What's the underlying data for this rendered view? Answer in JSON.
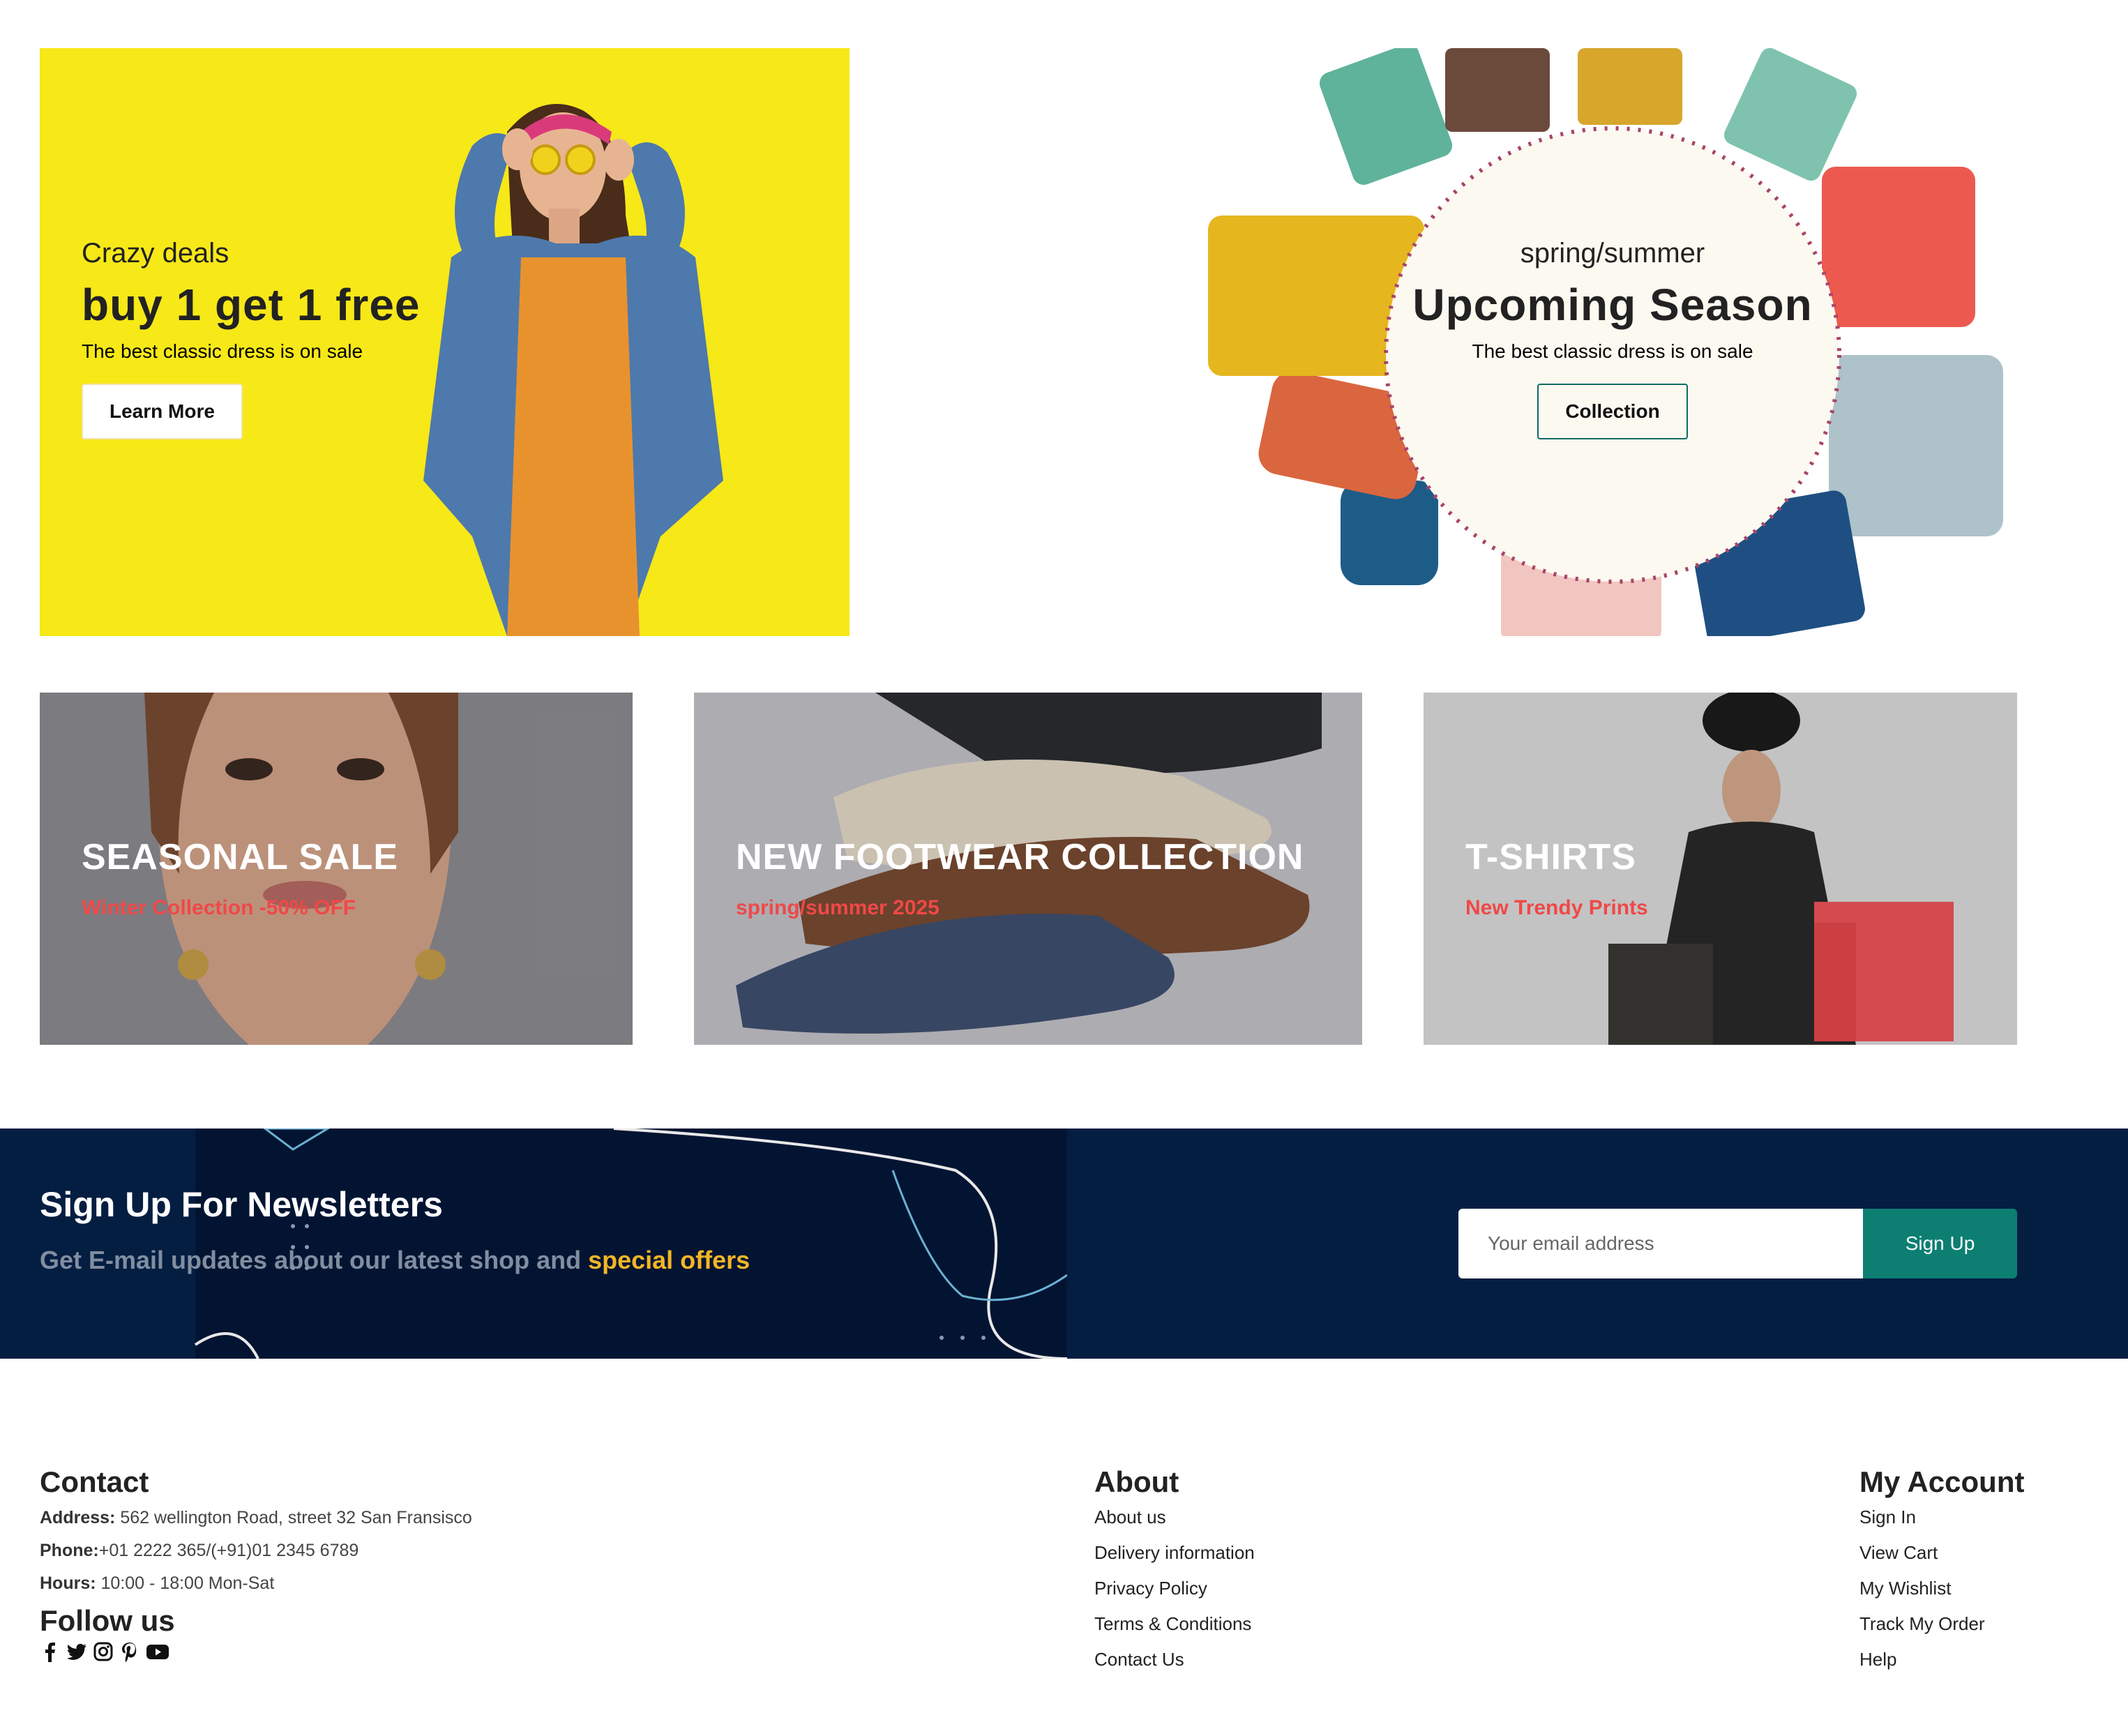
{
  "hero_left": {
    "kicker": "Crazy deals",
    "title": "buy 1 get 1 free",
    "subtitle": "The best classic dress is on sale",
    "button_label": "Learn More"
  },
  "hero_right": {
    "kicker": "spring/summer",
    "title": "Upcoming Season",
    "subtitle": "The best classic dress is on sale",
    "button_label": "Collection"
  },
  "cards": [
    {
      "title": "SEASONAL SALE",
      "subtitle": "Winter Collection -50% OFF"
    },
    {
      "title": "NEW FOOTWEAR COLLECTION",
      "subtitle": "spring/summer 2025"
    },
    {
      "title": "T-SHIRTS",
      "subtitle": "New Trendy Prints"
    }
  ],
  "newsletter": {
    "title": "Sign Up For Newsletters",
    "subtitle_prefix": "Get E-mail updates about our latest shop and ",
    "subtitle_highlight": "special offers",
    "input_placeholder": "Your email address",
    "button_label": "Sign Up"
  },
  "footer": {
    "contact": {
      "heading": "Contact",
      "address_label": "Address:",
      "address_value": " 562 wellington Road, street 32 San Fransisco",
      "phone_label": "Phone:",
      "phone_value": "+01 2222 365/(+91)01 2345 6789",
      "hours_label": "Hours:",
      "hours_value": " 10:00 - 18:00 Mon-Sat",
      "follow_heading": "Follow us",
      "social_icons": [
        "facebook-icon",
        "twitter-icon",
        "instagram-icon",
        "pinterest-icon",
        "youtube-icon"
      ]
    },
    "about": {
      "heading": "About",
      "links": [
        "About us",
        "Delivery information",
        "Privacy Policy",
        "Terms & Conditions",
        "Contact Us"
      ]
    },
    "account": {
      "heading": "My Account",
      "links": [
        "Sign In",
        "View Cart",
        "My Wishlist",
        "Track My Order",
        "Help"
      ]
    }
  },
  "colors": {
    "hero_yellow": "#f7e818",
    "newsletter_bg": "#041e42",
    "accent_red": "#f04848",
    "accent_yellow": "#f4b625",
    "signup_teal": "#0c7f72"
  }
}
